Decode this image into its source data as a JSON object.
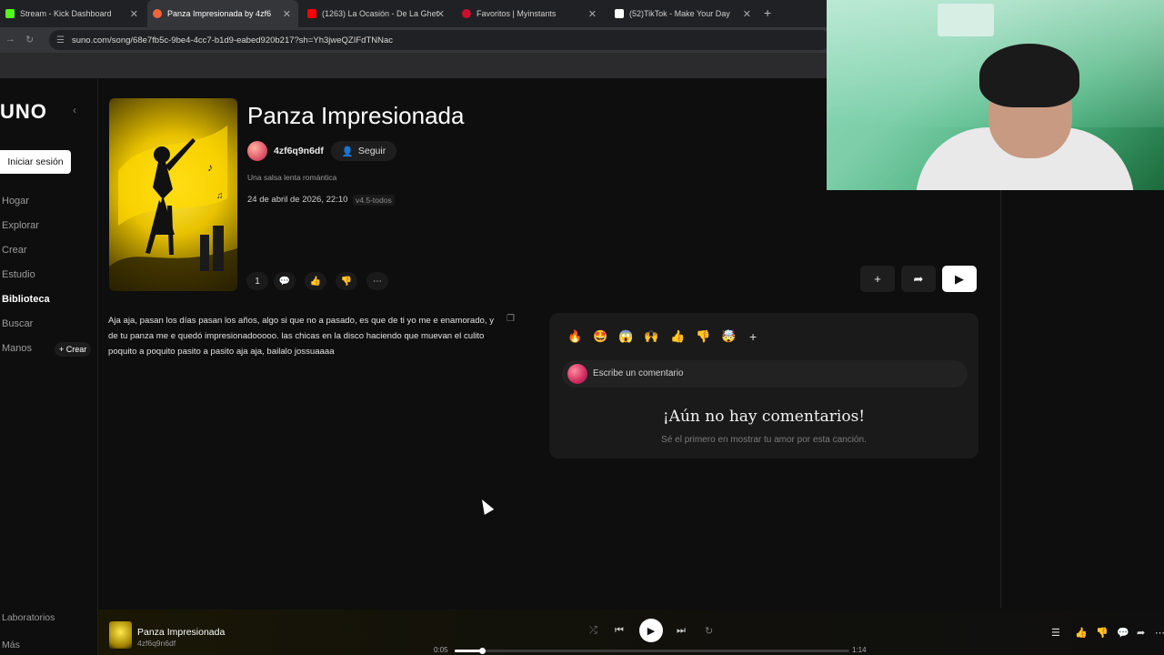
{
  "browser": {
    "tabs": [
      {
        "title": "Stream - Kick Dashboard",
        "icon_color": "#53fc18"
      },
      {
        "title": "Panza Impresionada by 4zf6",
        "icon_color": "#f0643c",
        "active": true
      },
      {
        "title": "(1263) La Ocasión - De La Ghet",
        "icon_color": "#ff0000"
      },
      {
        "title": "Favoritos | Myinstants",
        "icon_color": "#c8102e"
      },
      {
        "title": "(52)TikTok - Make Your Day",
        "icon_color": "#ffffff"
      }
    ],
    "new_tab": "+",
    "url": "suno.com/song/68e7fb5c-9be4-4cc7-b1d9-eabed920b217?sh=Yh3jweQZIFdTNNac"
  },
  "sidebar": {
    "logo": "UNO",
    "signin": "Iniciar sesión",
    "items": [
      {
        "label": "Hogar"
      },
      {
        "label": "Explorar"
      },
      {
        "label": "Crear"
      },
      {
        "label": "Estudio"
      },
      {
        "label": "Biblioteca",
        "active": true
      },
      {
        "label": "Buscar"
      },
      {
        "label": "Manos"
      }
    ],
    "crear_chip": "+ Crear",
    "bottom": [
      "Laboratorios",
      "Más"
    ]
  },
  "song": {
    "title": "Panza Impresionada",
    "artist": "4zf6q9n6df",
    "follow": "Seguir",
    "description": "Una salsa lenta romántica",
    "date": "24 de abril de 2026, 22:10",
    "version": "v4.5-todos",
    "action_count": "1",
    "lyrics": "Aja aja, pasan los días pasan los años, algo si que no a pasado, es que de ti yo me e enamorado, y de tu panza me e quedó impresionadooooo. las chicas en la disco haciendo que muevan el culito poquito a poquito pasito a pasito aja aja, bailalo jossuaaaa"
  },
  "comments": {
    "emojis": [
      "🔥",
      "🤩",
      "😱",
      "🙌",
      "👍",
      "👎",
      "🤯"
    ],
    "add": "+",
    "placeholder": "Escribe un comentario",
    "empty_title": "¡Aún no hay comentarios!",
    "empty_sub": "Sé el primero en mostrar tu amor por esta canción."
  },
  "player": {
    "title": "Panza Impresionada",
    "artist": "4zf6q9n6df",
    "current_time": "0:05",
    "duration": "1:14",
    "progress": 0.07
  }
}
